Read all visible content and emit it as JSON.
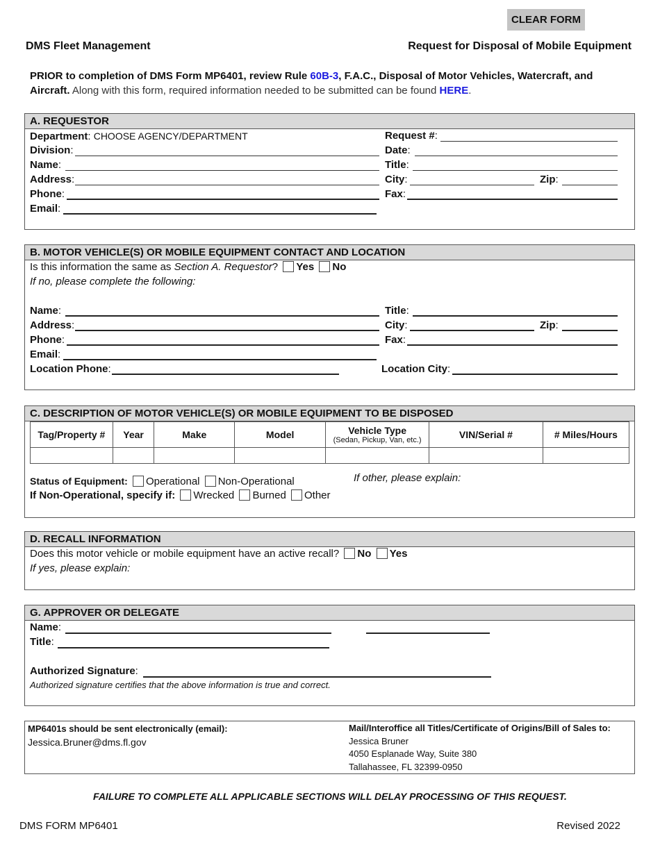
{
  "toolbar": {
    "clear_form_label": "CLEAR FORM"
  },
  "header": {
    "org": "DMS Fleet Management",
    "title": "Request for Disposal of Mobile Equipment"
  },
  "intro": {
    "part1": "PRIOR to completion of DMS Form MP6401, review Rule ",
    "rule_link": "60B-3",
    "part2": ", F.A.C., Disposal of Motor Vehicles, Watercraft, and Aircraft.",
    "part3": " Along with this form, required information needed to be submitted can be found ",
    "here_link": "HERE",
    "part4": "."
  },
  "section_a": {
    "title": "A.  REQUESTOR",
    "department_label": "Department",
    "department_value": "CHOOSE AGENCY/DEPARTMENT",
    "division_label": "Division",
    "name_label": "Name",
    "address_label": "Address",
    "phone_label": "Phone",
    "email_label": "Email",
    "request_label": "Request #",
    "date_label": "Date",
    "title_label": "Title",
    "city_label": "City",
    "zip_label": "Zip",
    "fax_label": "Fax"
  },
  "section_b": {
    "title": "B.  MOTOR VEHICLE(S) OR MOBILE EQUIPMENT CONTACT AND LOCATION",
    "question_part1": "Is this information the same as ",
    "question_ref": "Section A. Requestor",
    "question_part2": "?",
    "yes_label": "Yes",
    "no_label": "No",
    "instruction": "If no, please complete the following:",
    "name_label": "Name",
    "address_label": "Address",
    "phone_label": "Phone",
    "email_label": "Email",
    "location_phone_label": "Location Phone",
    "title_label": "Title",
    "city_label": "City",
    "zip_label": "Zip",
    "fax_label": "Fax",
    "location_city_label": "Location City"
  },
  "section_c": {
    "title": "C.  DESCRIPTION OF MOTOR VEHICLE(S) OR MOBILE EQUIPMENT TO BE DISPOSED",
    "columns": [
      {
        "label": "Tag/Property #",
        "sub": ""
      },
      {
        "label": "Year",
        "sub": ""
      },
      {
        "label": "Make",
        "sub": ""
      },
      {
        "label": "Model",
        "sub": ""
      },
      {
        "label": "Vehicle Type",
        "sub": "(Sedan, Pickup, Van, etc.)"
      },
      {
        "label": "VIN/Serial #",
        "sub": ""
      },
      {
        "label": "# Miles/Hours",
        "sub": ""
      }
    ],
    "rows": [
      [
        "",
        "",
        "",
        "",
        "",
        "",
        ""
      ]
    ],
    "status_label": "Status of Equipment:",
    "operational_label": "Operational",
    "non_operational_label": "Non-Operational",
    "other_explain": "If other, please explain:",
    "nonop_label": "If Non-Operational, specify if:",
    "wrecked_label": "Wrecked",
    "burned_label": "Burned",
    "other_label": "Other"
  },
  "section_d": {
    "title": "D. RECALL INFORMATION",
    "question": "Does this motor vehicle or mobile equipment have an active recall?",
    "no_label": "No",
    "yes_label": "Yes",
    "explain": "If yes, please explain:"
  },
  "section_g": {
    "title": "G.  APPROVER OR DELEGATE",
    "name_label": "Name",
    "title_label": "Title",
    "signature_label": "Authorized Signature",
    "certify_text": "Authorized signature certifies that the above information is true and correct."
  },
  "contact": {
    "email_heading": "MP6401s should be sent electronically (email):",
    "email": "Jessica.Bruner@dms.fl.gov",
    "mail_heading": "Mail/Interoffice all Titles/Certificate of Origins/Bill of Sales to:",
    "mail_name": "Jessica Bruner",
    "mail_street": "4050 Esplanade Way, Suite 380",
    "mail_city": "Tallahassee, FL  32399-0950"
  },
  "footer": {
    "warning": "FAILURE TO COMPLETE ALL APPLICABLE SECTIONS WILL DELAY PROCESSING OF THIS REQUEST.",
    "form_id": "DMS FORM MP6401",
    "revised": "Revised 2022"
  }
}
